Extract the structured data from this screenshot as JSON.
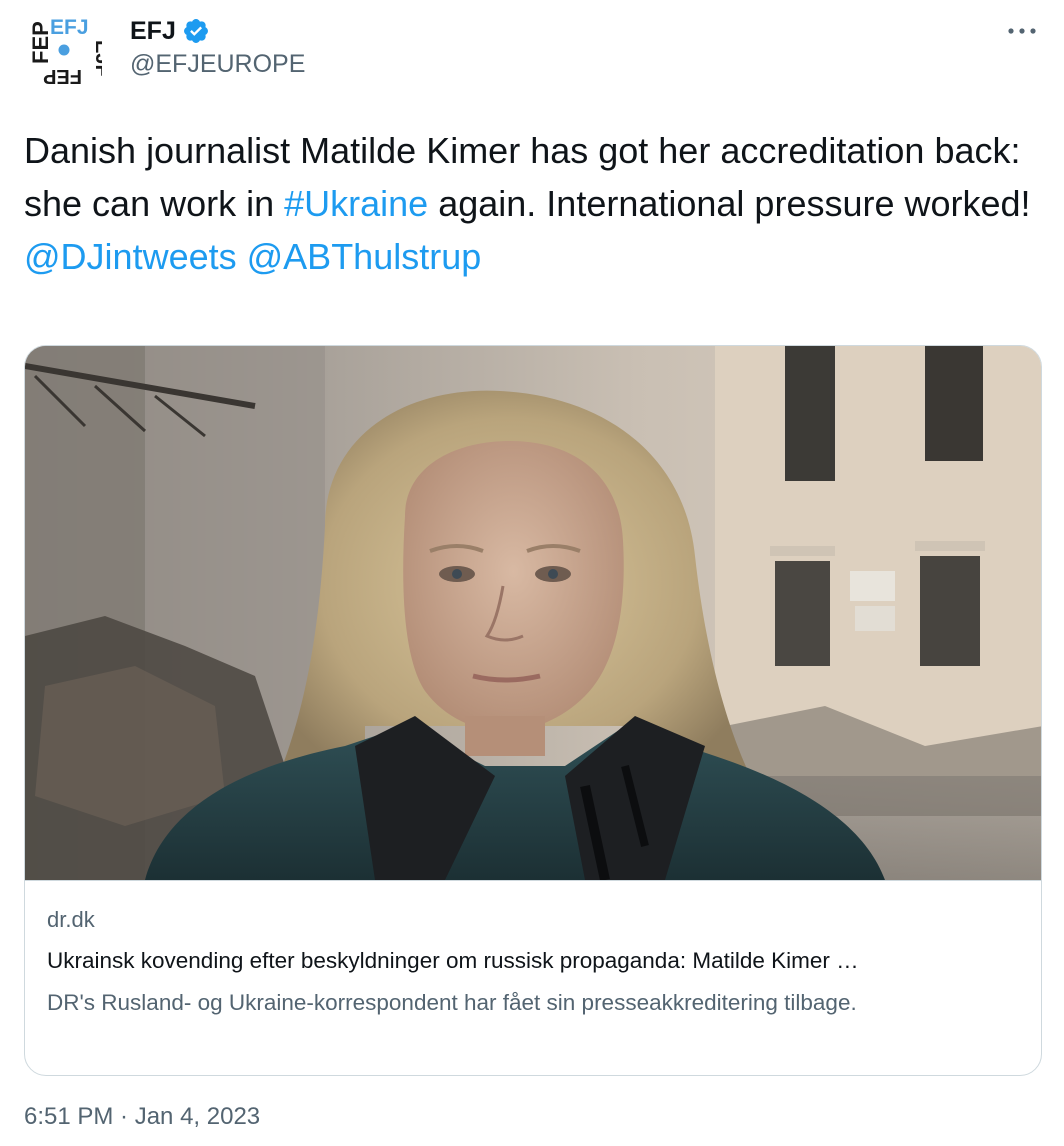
{
  "author": {
    "name": "EFJ",
    "handle": "@EFJEUROPE",
    "avatar_logo_text": [
      "FEP",
      "EFJ",
      "EJF"
    ]
  },
  "tweet": {
    "text_part1": "Danish journalist Matilde Kimer has got her accreditation back: she can work in ",
    "hashtag": "#Ukraine",
    "text_part2": " again. International pressure worked!",
    "mention1": "@DJintweets",
    "mention2": "@ABThulstrup"
  },
  "card": {
    "domain": "dr.dk",
    "title": "Ukrainsk kovending efter beskyldninger om russisk propaganda: Matilde Kimer …",
    "description": "DR's Rusland- og Ukraine-korrespondent har fået sin presseakkreditering tilbage."
  },
  "timestamp": "6:51 PM · Jan 4, 2023",
  "colors": {
    "link": "#1d9bf0",
    "secondary_text": "#536471",
    "primary_text": "#0f1419",
    "verified": "#1d9bf0",
    "border": "#cfd9de"
  },
  "icons": {
    "more": "more-horizontal-icon",
    "verified": "verified-badge-icon"
  }
}
